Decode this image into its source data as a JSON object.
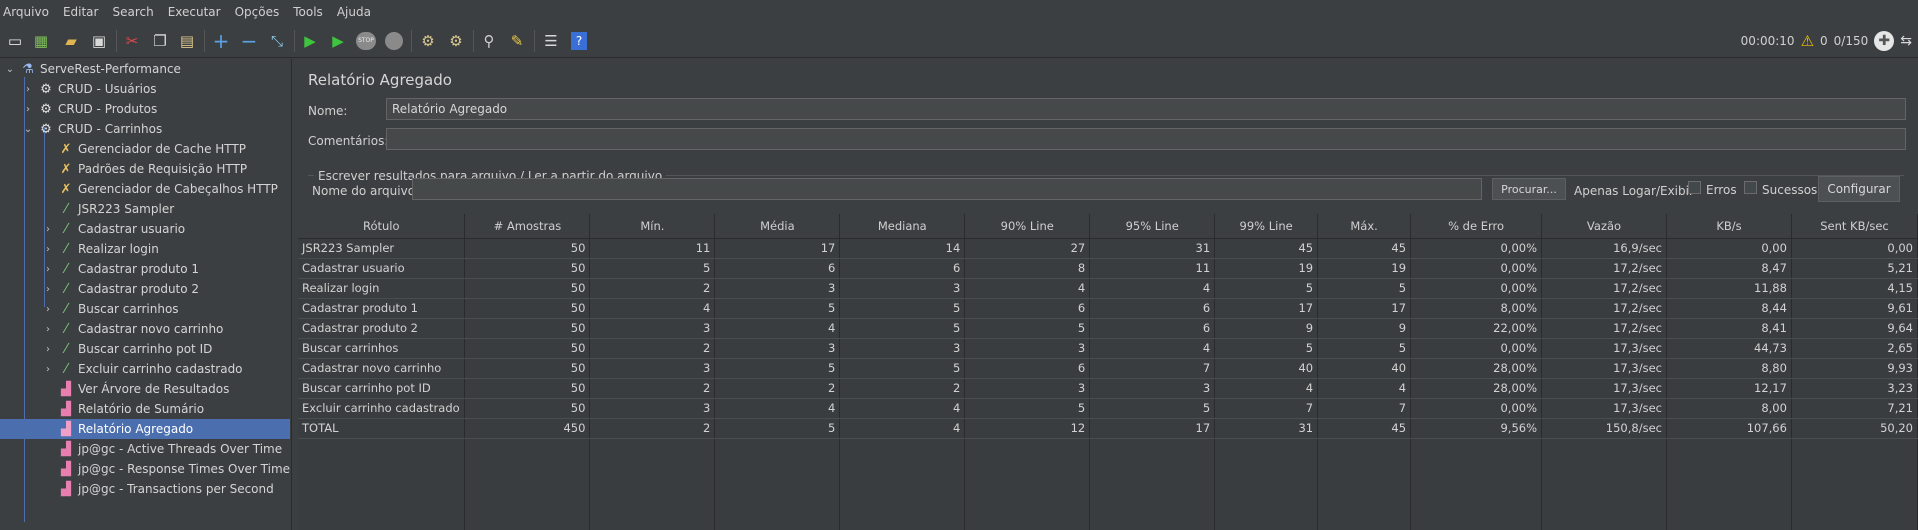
{
  "menu": [
    "Arquivo",
    "Editar",
    "Search",
    "Executar",
    "Opções",
    "Tools",
    "Ajuda"
  ],
  "toolbar": {
    "timer": "00:00:10",
    "warnings": "0",
    "threads": "0/150"
  },
  "tree": {
    "root": "ServeRest-Performance",
    "items": [
      {
        "label": "CRUD - Usuários",
        "icon": "gear-icon"
      },
      {
        "label": "CRUD - Produtos",
        "icon": "gear-icon"
      },
      {
        "label": "CRUD - Carrinhos",
        "icon": "gear-icon"
      },
      {
        "label": "Gerenciador de Cache HTTP",
        "icon": "tools-icon"
      },
      {
        "label": "Padrões de Requisição HTTP",
        "icon": "tools-icon"
      },
      {
        "label": "Gerenciador de Cabeçalhos HTTP",
        "icon": "tools-icon"
      },
      {
        "label": "JSR223 Sampler",
        "icon": "sampler-icon"
      },
      {
        "label": "Cadastrar usuario",
        "icon": "sampler-icon"
      },
      {
        "label": "Realizar login",
        "icon": "sampler-icon"
      },
      {
        "label": "Cadastrar produto 1",
        "icon": "sampler-icon"
      },
      {
        "label": "Cadastrar produto 2",
        "icon": "sampler-icon"
      },
      {
        "label": "Buscar carrinhos",
        "icon": "sampler-icon"
      },
      {
        "label": "Cadastrar novo carrinho",
        "icon": "sampler-icon"
      },
      {
        "label": "Buscar carrinho pot ID",
        "icon": "sampler-icon"
      },
      {
        "label": "Excluir carrinho cadastrado",
        "icon": "sampler-icon"
      },
      {
        "label": "Ver Árvore de Resultados",
        "icon": "listener-icon"
      },
      {
        "label": "Relatório de Sumário",
        "icon": "listener-icon"
      },
      {
        "label": "Relatório Agregado",
        "icon": "listener-icon"
      },
      {
        "label": "jp@gc - Active Threads Over Time",
        "icon": "listener-icon"
      },
      {
        "label": "jp@gc - Response Times Over Time",
        "icon": "listener-icon"
      },
      {
        "label": "jp@gc - Transactions per Second",
        "icon": "listener-icon"
      }
    ]
  },
  "panel": {
    "title": "Relatório Agregado",
    "name_label": "Nome:",
    "name_value": "Relatório Agregado",
    "comments_label": "Comentários:",
    "comments_value": "",
    "group_title": "Escrever resultados para arquivo / Ler a partir do arquivo",
    "filename_label": "Nome do arquivo",
    "filename_value": "",
    "browse_button": "Procurar...",
    "log_only_label": "Apenas Logar/Exibir",
    "errors_label": "Erros",
    "success_label": "Sucessos",
    "configure_button": "Configurar"
  },
  "table": {
    "headers": [
      "Rótulo",
      "# Amostras",
      "Mín.",
      "Média",
      "Mediana",
      "90% Line",
      "95% Line",
      "99% Line",
      "Máx.",
      "% de Erro",
      "Vazão",
      "KB/s",
      "Sent KB/sec"
    ],
    "rows": [
      [
        "JSR223 Sampler",
        "50",
        "11",
        "17",
        "14",
        "27",
        "31",
        "45",
        "45",
        "0,00%",
        "16,9/sec",
        "0,00",
        "0,00"
      ],
      [
        "Cadastrar usuario",
        "50",
        "5",
        "6",
        "6",
        "8",
        "11",
        "19",
        "19",
        "0,00%",
        "17,2/sec",
        "8,47",
        "5,21"
      ],
      [
        "Realizar login",
        "50",
        "2",
        "3",
        "3",
        "4",
        "4",
        "5",
        "5",
        "0,00%",
        "17,2/sec",
        "11,88",
        "4,15"
      ],
      [
        "Cadastrar produto 1",
        "50",
        "4",
        "5",
        "5",
        "6",
        "6",
        "17",
        "17",
        "8,00%",
        "17,2/sec",
        "8,44",
        "9,61"
      ],
      [
        "Cadastrar produto 2",
        "50",
        "3",
        "4",
        "5",
        "5",
        "6",
        "9",
        "9",
        "22,00%",
        "17,2/sec",
        "8,41",
        "9,64"
      ],
      [
        "Buscar carrinhos",
        "50",
        "2",
        "3",
        "3",
        "3",
        "4",
        "5",
        "5",
        "0,00%",
        "17,3/sec",
        "44,73",
        "2,65"
      ],
      [
        "Cadastrar novo carrinho",
        "50",
        "3",
        "5",
        "5",
        "6",
        "7",
        "40",
        "40",
        "28,00%",
        "17,3/sec",
        "8,80",
        "9,93"
      ],
      [
        "Buscar carrinho pot ID",
        "50",
        "2",
        "2",
        "2",
        "3",
        "3",
        "4",
        "4",
        "28,00%",
        "17,3/sec",
        "12,17",
        "3,23"
      ],
      [
        "Excluir carrinho cadastrado",
        "50",
        "3",
        "4",
        "4",
        "5",
        "5",
        "7",
        "7",
        "0,00%",
        "17,3/sec",
        "8,00",
        "7,21"
      ],
      [
        "TOTAL",
        "450",
        "2",
        "5",
        "4",
        "12",
        "17",
        "31",
        "45",
        "9,56%",
        "150,8/sec",
        "107,66",
        "50,20"
      ]
    ]
  }
}
